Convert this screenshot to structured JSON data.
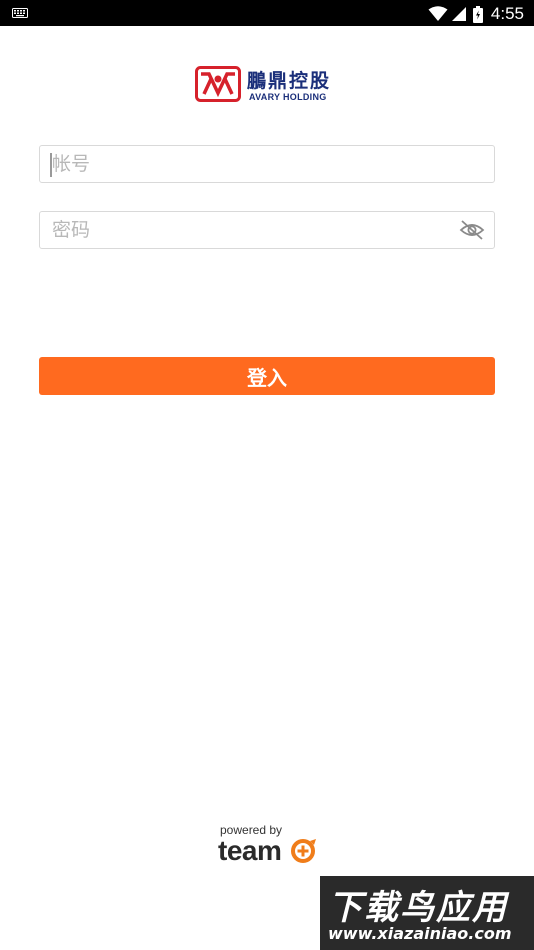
{
  "status_bar": {
    "time": "4:55",
    "icons": [
      "keyboard-icon",
      "wifi-icon",
      "signal-icon",
      "battery-icon"
    ]
  },
  "logo": {
    "name_cn": "鵬鼎控股",
    "name_en": "AVARY HOLDING",
    "brand_color": "#d6212b",
    "text_color": "#1b2f7a"
  },
  "login_form": {
    "account_placeholder": "帐号",
    "account_value": "",
    "password_placeholder": "密码",
    "password_value": "",
    "visibility_icon": "eye-off-icon",
    "submit_label": "登入",
    "submit_color": "#ff6a1f"
  },
  "footer": {
    "powered_by": "powered by",
    "brand": "team"
  },
  "watermark": {
    "title": "下载鸟应用",
    "url": "www.xiazainiao.com"
  }
}
